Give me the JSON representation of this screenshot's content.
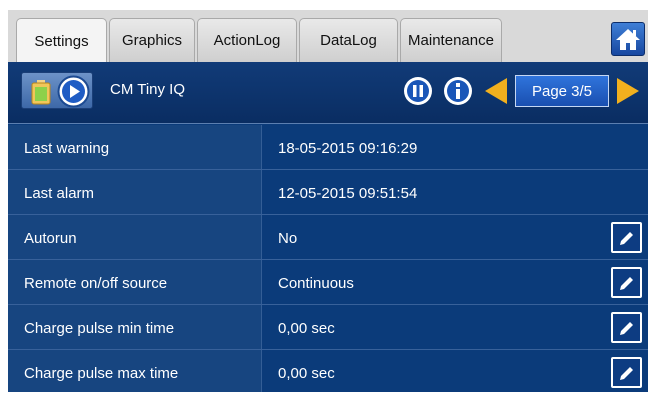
{
  "tabs": [
    {
      "label": "Settings",
      "active": true
    },
    {
      "label": "Graphics",
      "active": false
    },
    {
      "label": "ActionLog",
      "active": false
    },
    {
      "label": "DataLog",
      "active": false
    },
    {
      "label": "Maintenance",
      "active": false
    }
  ],
  "header": {
    "device_name": "CM Tiny IQ",
    "page_label": "Page 3/5"
  },
  "icons": {
    "home": "home-icon",
    "battery": "battery-icon",
    "play": "play-icon",
    "pause": "pause-icon",
    "info": "info-icon",
    "prev": "arrow-left-icon",
    "next": "arrow-right-icon",
    "edit": "pencil-icon"
  },
  "colors": {
    "panel_background": "#0b3b7a",
    "accent_yellow": "#f2b01e",
    "page_button": "#2f74dc"
  },
  "rows": [
    {
      "label": "Last warning",
      "value": "18-05-2015  09:16:29",
      "editable": false
    },
    {
      "label": "Last alarm",
      "value": "12-05-2015  09:51:54",
      "editable": false
    },
    {
      "label": "Autorun",
      "value": "No",
      "editable": true
    },
    {
      "label": "Remote on/off source",
      "value": "Continuous",
      "editable": true
    },
    {
      "label": "Charge pulse min time",
      "value": "0,00 sec",
      "editable": true
    },
    {
      "label": "Charge pulse max time",
      "value": "0,00 sec",
      "editable": true
    }
  ]
}
